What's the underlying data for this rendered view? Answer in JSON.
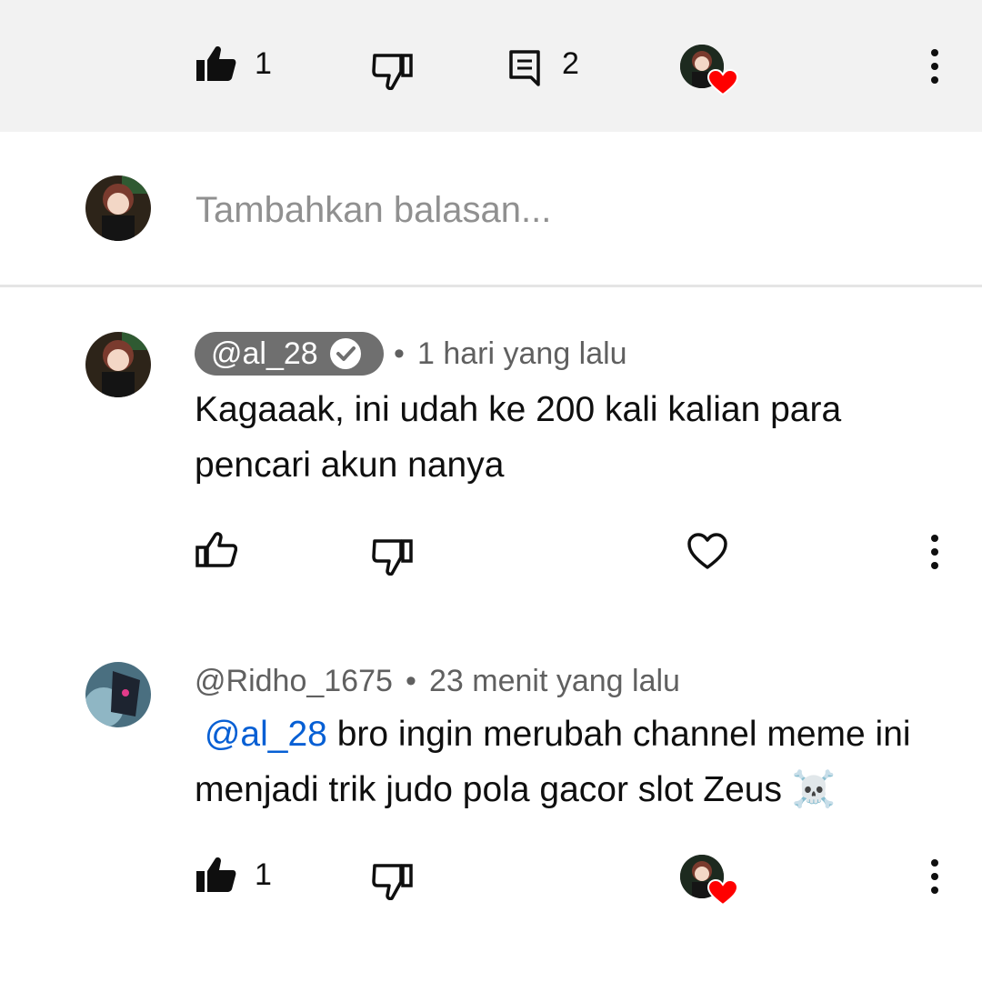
{
  "top_actions": {
    "like_count": "1",
    "reply_count": "2"
  },
  "reply_box": {
    "placeholder": "Tambahkan balasan..."
  },
  "comments": [
    {
      "author": "@al_28",
      "verified_owner": true,
      "time": "1 hari yang lalu",
      "text": "Kagaaak, ini udah ke 200 kali kalian para pencari akun nanya",
      "like_count": ""
    },
    {
      "author": "@Ridho_1675",
      "verified_owner": false,
      "time": "23 menit yang lalu",
      "mention": "@al_28",
      "text": "bro ingin merubah channel meme ini menjadi trik judo pola gacor slot Zeus",
      "emoji": "☠️",
      "like_count": "1"
    }
  ],
  "separator": "•",
  "colors": {
    "topbar_bg": "#f2f2f2",
    "mention": "#065fd4",
    "heart": "#ff0000",
    "owner_pill": "#6f6f6f"
  },
  "icons": [
    "thumbs-up-filled-icon",
    "thumbs-down-icon",
    "reply-icon",
    "creator-heart-icon",
    "more-vert-icon",
    "thumbs-up-outline-icon",
    "heart-outline-icon",
    "verified-check-icon"
  ]
}
